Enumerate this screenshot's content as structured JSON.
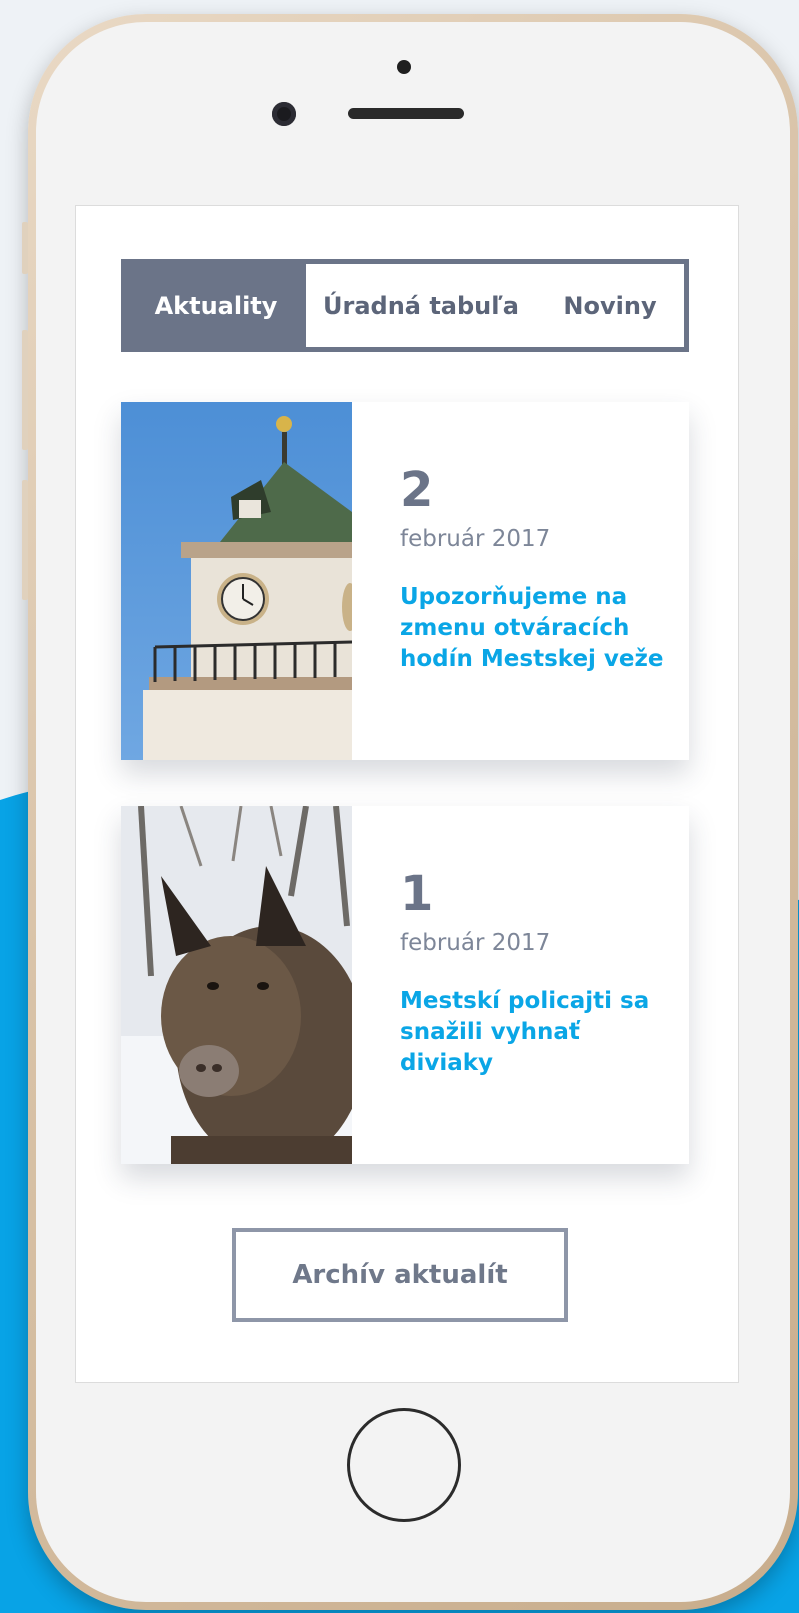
{
  "colors": {
    "accent_blue": "#0aa6e6",
    "tab_active_bg": "#6b7488",
    "background": "#eef2f6",
    "phone_frame": "#d9c3a8"
  },
  "tabs": [
    {
      "label": "Aktuality",
      "active": true
    },
    {
      "label": "Úradná tabuľa",
      "active": false
    },
    {
      "label": "Noviny",
      "active": false
    }
  ],
  "news": [
    {
      "day": "2",
      "month": "február 2017",
      "title": "Upozorňujeme na zmenu otváracích hodín Mestskej veže",
      "image": "clock-tower-image"
    },
    {
      "day": "1",
      "month": "február 2017",
      "title": "Mestskí policajti sa snažili vyhnať diviaky",
      "image": "wild-boar-image"
    }
  ],
  "archive_button": "Archív aktualít"
}
